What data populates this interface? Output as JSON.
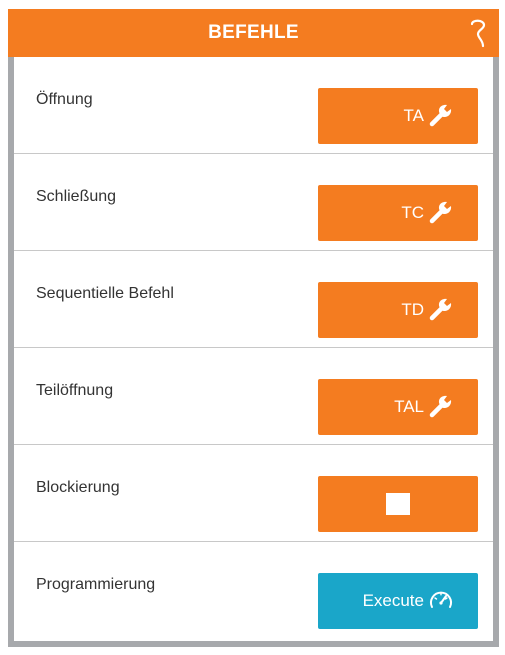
{
  "header": {
    "title": "BEFEHLE"
  },
  "colors": {
    "accent": "#f47c20",
    "execute": "#1aa6c9",
    "panel_border": "#a7a9ac"
  },
  "rows": [
    {
      "label": "Öffnung",
      "button_label": "TA",
      "icon": "wrench-icon"
    },
    {
      "label": "Schließung",
      "button_label": "TC",
      "icon": "wrench-icon"
    },
    {
      "label": "Sequentielle Befehl",
      "button_label": "TD",
      "icon": "wrench-icon"
    },
    {
      "label": "Teilöffnung",
      "button_label": "TAL",
      "icon": "wrench-icon"
    },
    {
      "label": "Blockierung",
      "button_label": "",
      "icon": "stop-icon"
    },
    {
      "label": "Programmierung",
      "button_label": "Execute",
      "icon": "speedometer-icon"
    }
  ]
}
